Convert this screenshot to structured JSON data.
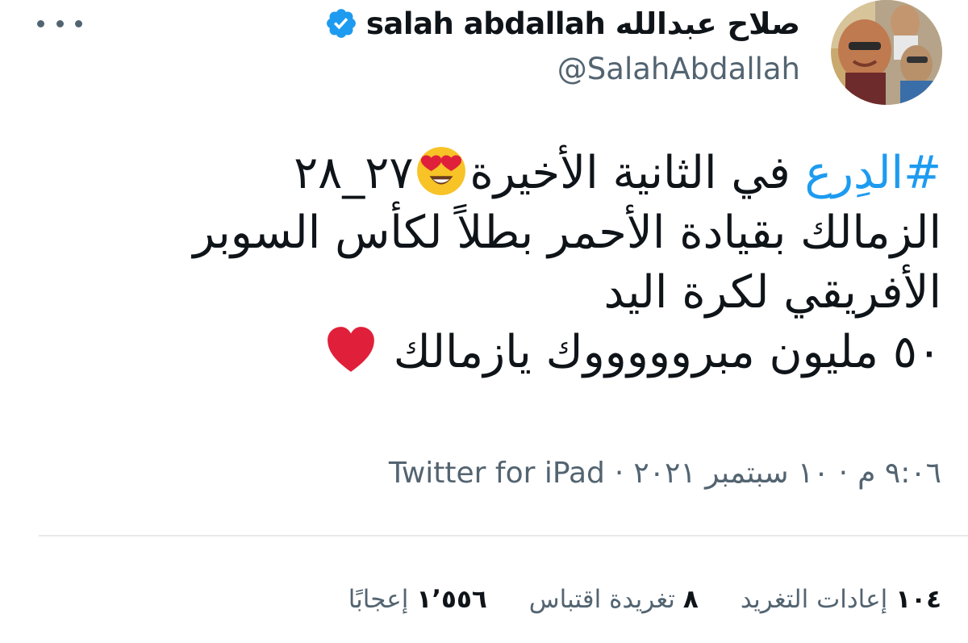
{
  "tweet": {
    "author": {
      "display_name": "salah abdallah صلاح عبدالله",
      "handle": "@SalahAbdallah",
      "verified": true
    },
    "body": {
      "hashtag": "#الدِرع",
      "line1_text": "في الثانية الأخيرة",
      "line1_score": "٢٧_٢٨",
      "line2": "الزمالك بقيادة الأحمر بطلاً لكأس السوبر",
      "line3": "الأفريقي لكرة اليد",
      "line4": "٥٠ مليون مبروووووك يازمالك",
      "emoji_1": "heart-eyes-emoji",
      "emoji_2": "red-heart-emoji"
    },
    "meta": {
      "time": "٩:٠٦ م",
      "separator_1": "·",
      "date": "١٠ سبتمبر ٢٠٢١",
      "separator_2": "·",
      "source": "Twitter for iPad"
    },
    "stats": {
      "retweets_count": "١٠٤",
      "retweets_label": "إعادات التغريد",
      "quotes_count": "٨",
      "quotes_label": "تغريدة اقتباس",
      "likes_count": "١٬٥٥٦",
      "likes_label": "إعجابًا"
    }
  },
  "colors": {
    "text": "#0f1419",
    "secondary": "#536471",
    "link": "#1d9bf0",
    "verified": "#1d9bf0",
    "heart": "#e0203a"
  },
  "icons": [
    "more-icon",
    "verified-badge-icon",
    "heart-eyes-emoji",
    "red-heart-emoji"
  ]
}
